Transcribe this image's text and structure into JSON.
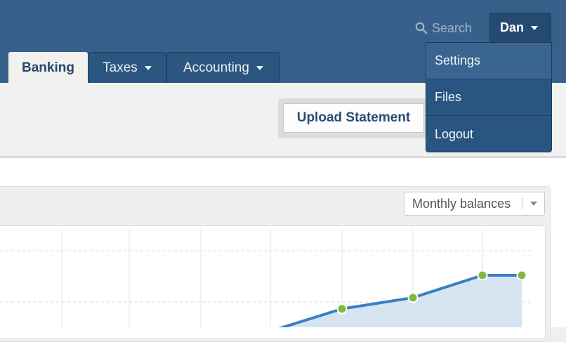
{
  "header": {
    "search_label": "Search",
    "user_name": "Dan",
    "colors": {
      "bar": "#37618a",
      "menu": "#2a5583",
      "tab": "#2c5580"
    }
  },
  "tabs": [
    {
      "label": "Banking",
      "active": true
    },
    {
      "label": "Taxes",
      "has_dropdown": true
    },
    {
      "label": "Accounting",
      "has_dropdown": true
    }
  ],
  "toolbar": {
    "upload_label": "Upload Statement"
  },
  "user_menu": {
    "items": [
      {
        "label": "Settings",
        "highlighted": true
      },
      {
        "label": "Files"
      },
      {
        "label": "Logout"
      }
    ]
  },
  "balances": {
    "select_value": "Monthly balances"
  },
  "chart_data": {
    "type": "area",
    "title": "",
    "xlabel": "",
    "ylabel": "",
    "grid": true,
    "x": [
      1,
      2,
      3,
      4,
      5,
      6,
      7,
      8
    ],
    "values": [
      0,
      8,
      12,
      34,
      45,
      67,
      67
    ],
    "line_color": "#3a7fc3",
    "fill_color": "#d5e4f2",
    "point_color": "#7fba3f"
  }
}
